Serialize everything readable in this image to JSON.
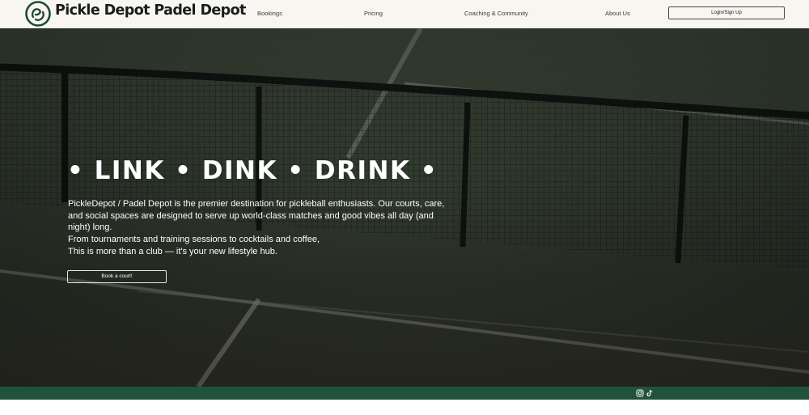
{
  "brand": {
    "name": "Pickle Depot Padel Depot"
  },
  "nav": [
    {
      "label": "Bookings"
    },
    {
      "label": "Pricing"
    },
    {
      "label": "Coaching & Community"
    },
    {
      "label": "About Us"
    }
  ],
  "header": {
    "login_label": "Login/Sign Up"
  },
  "hero": {
    "title": "• LINK • DINK • DRINK •",
    "paragraph1": "PickleDepot / Padel Depot is the premier destination for pickleball enthusiasts. Our courts, care, and social spaces are designed to serve up world-class matches and good vibes all day (and night) long.",
    "paragraph2_line1": "From tournaments and training sessions to cocktails and coffee,",
    "paragraph2_line2": "This is more than a club — it's your new lifestyle hub.",
    "cta_label": "Book a court!"
  },
  "footer": {
    "icons": [
      "instagram-icon",
      "tiktok-icon"
    ]
  },
  "colors": {
    "header_bg": "#f8f6f1",
    "footer_green": "#21533a",
    "logo_green": "#1f4a35"
  }
}
